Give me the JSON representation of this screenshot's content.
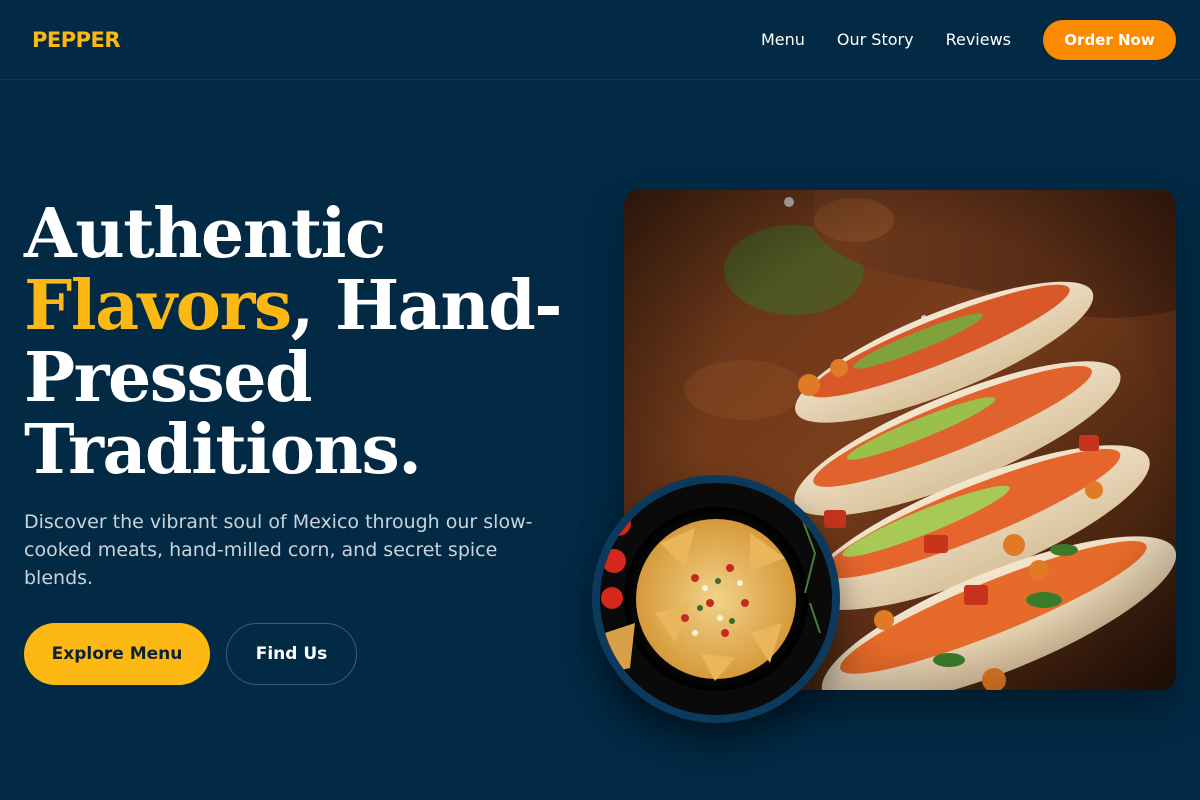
{
  "brand": {
    "name": "PEPPER"
  },
  "nav": {
    "links": [
      "Menu",
      "Our Story",
      "Reviews"
    ],
    "cta": "Order Now"
  },
  "hero": {
    "title_line1": "Authentic",
    "title_accent": "Flavors",
    "title_after_accent": ", Hand-",
    "title_line3": "Pressed",
    "title_line4": "Traditions.",
    "subtitle": "Discover the vibrant soul of Mexico through our slow-cooked meats, hand-milled corn, and secret spice blends.",
    "primary_button": "Explore Menu",
    "secondary_button": "Find Us"
  },
  "images": {
    "main": "tacos-photo",
    "secondary": "nachos-photo"
  },
  "colors": {
    "background": "#022a45",
    "brand_yellow": "#fdb813",
    "order_orange": "#fb8a00",
    "text_white": "#ffffff",
    "text_muted": "#c9d3dc"
  }
}
